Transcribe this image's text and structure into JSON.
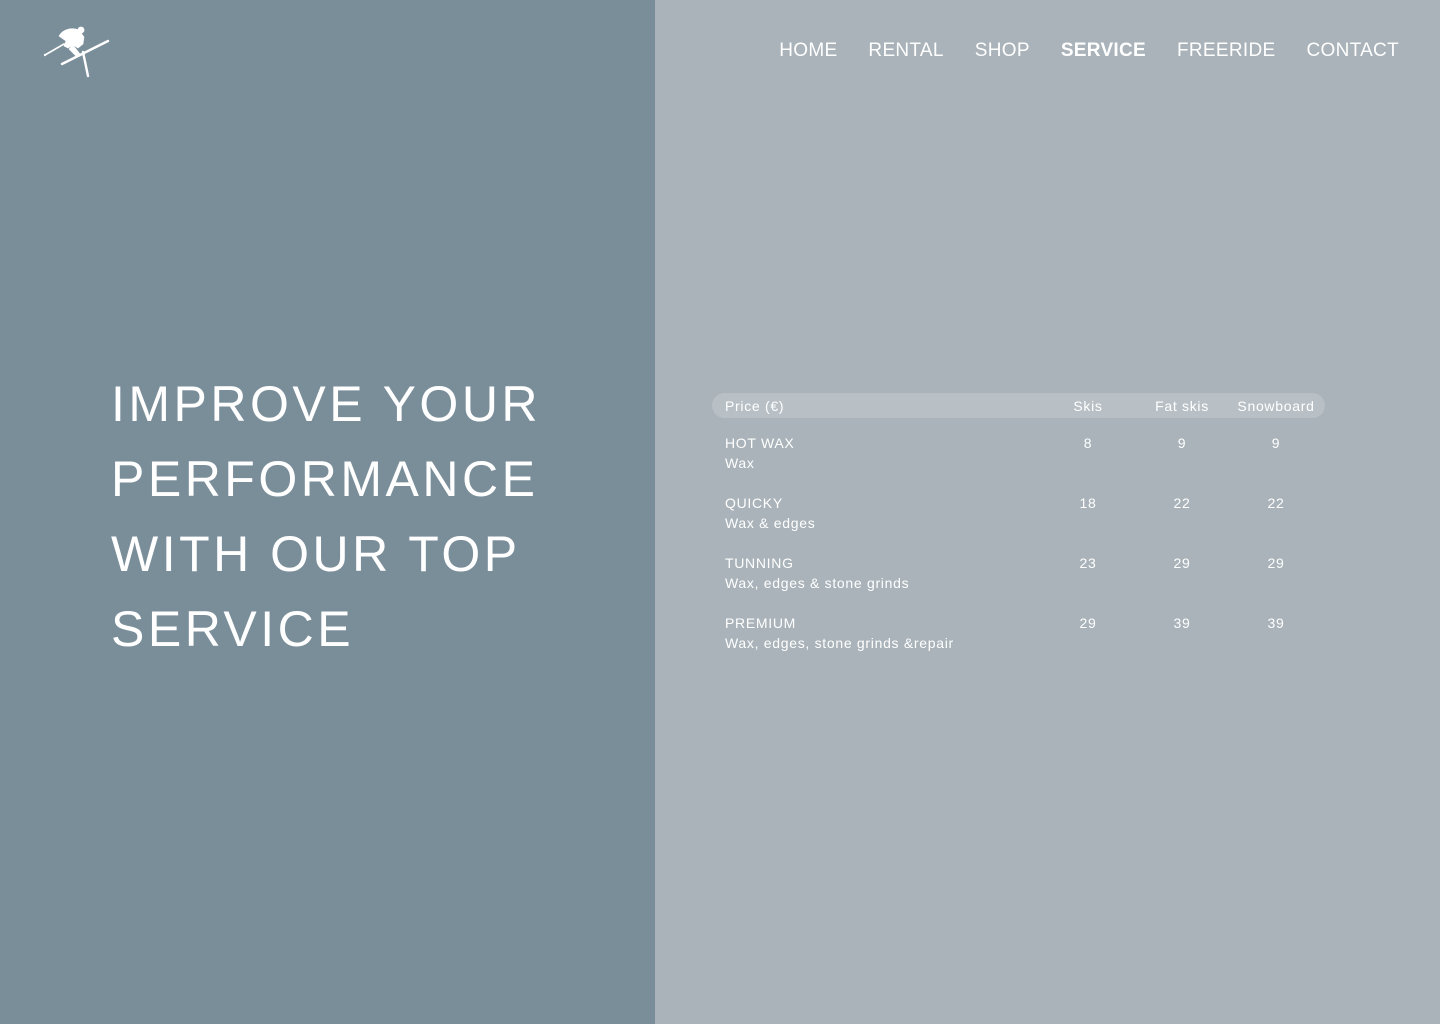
{
  "nav": {
    "items": [
      {
        "label": "HOME",
        "active": false
      },
      {
        "label": "RENTAL",
        "active": false
      },
      {
        "label": "SHOP",
        "active": false
      },
      {
        "label": "SERVICE",
        "active": true
      },
      {
        "label": "FREERIDE",
        "active": false
      },
      {
        "label": "CONTACT",
        "active": false
      }
    ]
  },
  "logo": {
    "icon": "skier-icon"
  },
  "hero": {
    "lines": [
      "IMPROVE YOUR",
      "PERFORMANCE",
      "WITH OUR TOP",
      "SERVICE"
    ]
  },
  "price_table": {
    "headers": [
      "Price (€)",
      "Skis",
      "Fat skis",
      "Snowboard"
    ],
    "rows": [
      {
        "name": "HOT WAX",
        "desc": "Wax",
        "skis": "8",
        "fat_skis": "9",
        "snowboard": "9"
      },
      {
        "name": "QUICKY",
        "desc": "Wax & edges",
        "skis": "18",
        "fat_skis": "22",
        "snowboard": "22"
      },
      {
        "name": "TUNNING",
        "desc": "Wax, edges & stone grinds",
        "skis": "23",
        "fat_skis": "29",
        "snowboard": "29"
      },
      {
        "name": "PREMIUM",
        "desc": "Wax, edges, stone grinds &repair",
        "skis": "29",
        "fat_skis": "39",
        "snowboard": "39"
      }
    ]
  },
  "colors": {
    "left_panel": "#7a8e9a",
    "right_panel": "#a9b3b9",
    "table_header": "#b8c0c6",
    "text": "#ffffff"
  }
}
